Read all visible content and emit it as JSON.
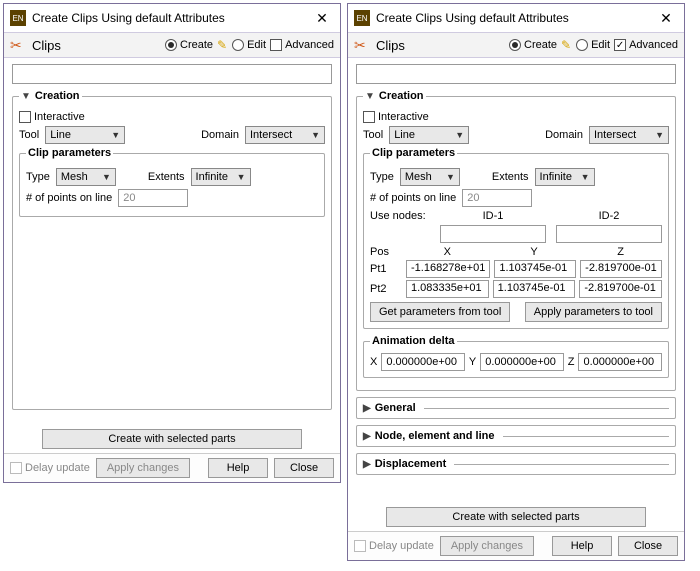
{
  "left": {
    "title": "Create Clips Using default Attributes",
    "section": "Clips",
    "modes": {
      "create": "Create",
      "edit": "Edit",
      "advanced": "Advanced"
    },
    "creation": {
      "label": "Creation",
      "interactive": "Interactive",
      "tool_lbl": "Tool",
      "tool": "Line",
      "domain_lbl": "Domain",
      "domain": "Intersect",
      "clip_params": "Clip parameters",
      "type_lbl": "Type",
      "type": "Mesh",
      "extents_lbl": "Extents",
      "extents": "Infinite",
      "npts_lbl": "# of points on line",
      "npts": "20",
      "create_btn": "Create with selected parts"
    },
    "footer": {
      "delay": "Delay update",
      "apply": "Apply changes",
      "help": "Help",
      "close": "Close"
    }
  },
  "right": {
    "title": "Create Clips Using default Attributes",
    "section": "Clips",
    "modes": {
      "create": "Create",
      "edit": "Edit",
      "advanced": "Advanced"
    },
    "creation": {
      "label": "Creation",
      "interactive": "Interactive",
      "tool_lbl": "Tool",
      "tool": "Line",
      "domain_lbl": "Domain",
      "domain": "Intersect",
      "clip_params": "Clip parameters",
      "type_lbl": "Type",
      "type": "Mesh",
      "extents_lbl": "Extents",
      "extents": "Infinite",
      "npts_lbl": "# of points on line",
      "npts": "20",
      "use_nodes": "Use nodes:",
      "id1": "ID-1",
      "id2": "ID-2",
      "pos": "Pos",
      "x": "X",
      "y": "Y",
      "z": "Z",
      "pt1": "Pt1",
      "pt1x": "-1.168278e+01",
      "pt1y": "1.103745e-01",
      "pt1z": "-2.819700e-01",
      "pt2": "Pt2",
      "pt2x": "1.083335e+01",
      "pt2y": "1.103745e-01",
      "pt2z": "-2.819700e-01",
      "get_btn": "Get parameters from tool",
      "apply_btn": "Apply parameters to tool",
      "anim_label": "Animation delta",
      "ax": "0.000000e+00",
      "ay": "0.000000e+00",
      "az": "0.000000e+00",
      "create_btn": "Create with selected parts"
    },
    "collapsed": {
      "general": "General",
      "node": "Node, element and line",
      "disp": "Displacement"
    },
    "footer": {
      "delay": "Delay update",
      "apply": "Apply changes",
      "help": "Help",
      "close": "Close"
    }
  }
}
